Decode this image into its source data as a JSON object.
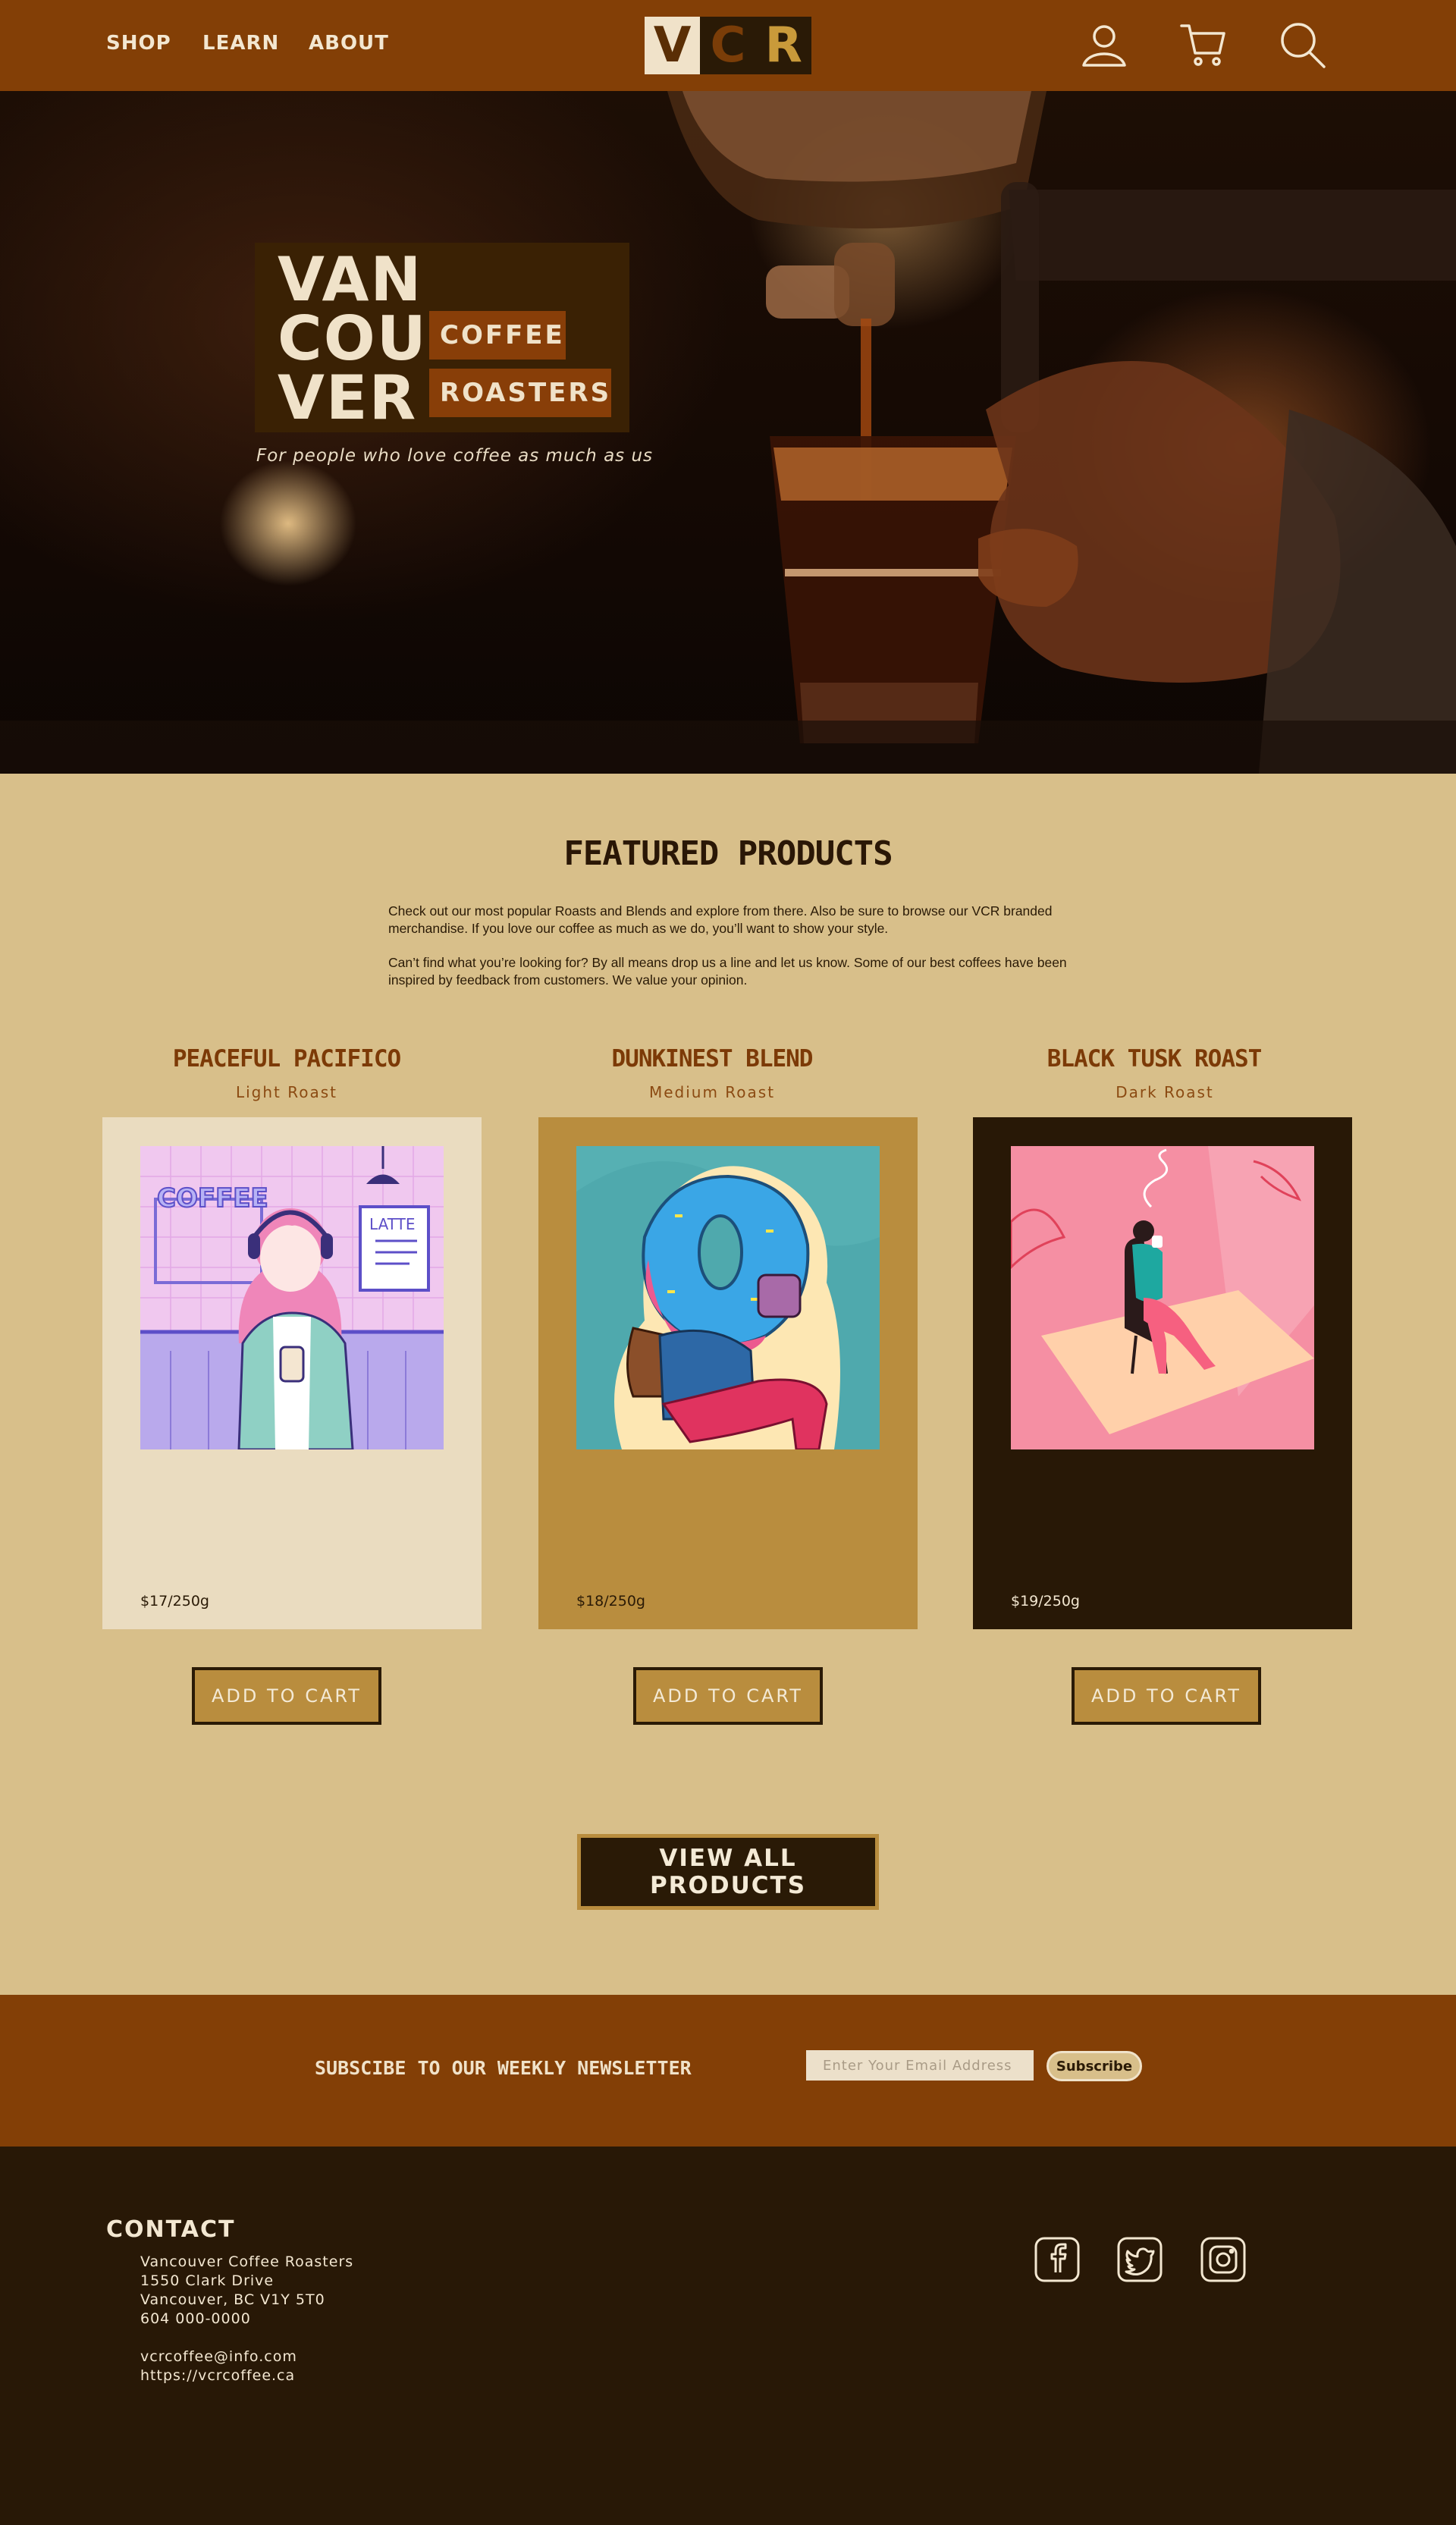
{
  "header": {
    "nav": [
      "SHOP",
      "LEARN",
      "ABOUT"
    ],
    "logo_letters": [
      "V",
      "C",
      "R"
    ],
    "icons": [
      "account-icon",
      "cart-icon",
      "search-icon"
    ]
  },
  "hero": {
    "brand_lines": [
      "VAN",
      "COU",
      "VER"
    ],
    "brand_tag_1": "COFFEE",
    "brand_tag_2": "ROASTERS",
    "tagline": "For people who love coffee as much as us"
  },
  "featured": {
    "title": "FEATURED PRODUCTS",
    "intro_1": "Check out our most popular Roasts and Blends and explore from there. Also be sure to browse our VCR branded merchandise. If you love our coffee as much as we do, you’ll want to show your style.",
    "intro_2": "Can’t find what you’re looking for? By all means drop us a line and let us know. Some of our best coffees have been inspired by feedback from customers. We value your opinion.",
    "products": [
      {
        "name": "PEACEFUL PACIFICO",
        "roast": "Light  Roast",
        "price": "$17/250g",
        "button": "ADD TO CART",
        "card_color": "#eadcc0",
        "price_color": "#2a1a06"
      },
      {
        "name": "DUNKINEST BLEND",
        "roast": "Medium  Roast",
        "price": "$18/250g",
        "button": "ADD TO CART",
        "card_color": "#b98d3e",
        "price_color": "#2a1a06"
      },
      {
        "name": "BLACK TUSK ROAST",
        "roast": "Dark Roast",
        "price": "$19/250g",
        "button": "ADD TO CART",
        "card_color": "#281806",
        "price_color": "#f3e7d1"
      }
    ],
    "view_all": "VIEW ALL PRODUCTS"
  },
  "newsletter": {
    "label": "SUBSCIBE TO OUR WEEKLY NEWSLETTER",
    "placeholder": "Enter Your Email Address",
    "button": "Subscribe"
  },
  "footer": {
    "contact_title": "CONTACT",
    "address": [
      "Vancouver Coffee Roasters",
      "1550 Clark Drive",
      "Vancouver, BC V1Y 5T0",
      "604 000-0000"
    ],
    "online": [
      "vcrcoffee@info.com",
      "https://vcrcoffee.ca"
    ],
    "social": [
      "facebook-icon",
      "twitter-icon",
      "instagram-icon"
    ]
  },
  "colors": {
    "header_bg": "#833f06",
    "page_bg": "#d8bf8a",
    "footer_bg": "#281806",
    "accent_gold": "#b98d3e",
    "cream": "#f0e2c9"
  }
}
